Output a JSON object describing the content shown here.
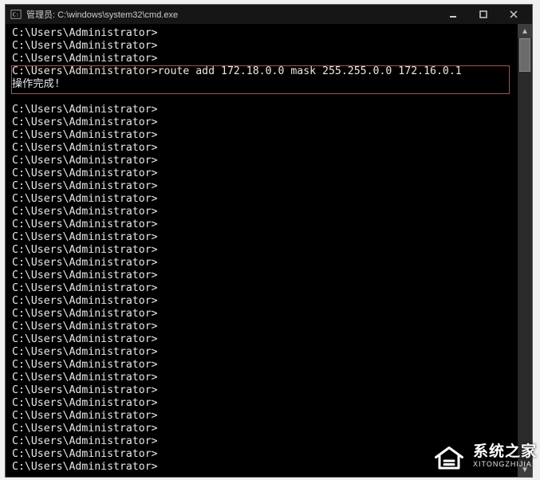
{
  "window": {
    "icon": "cmd-icon",
    "title": "管理员: C:\\windows\\system32\\cmd.exe"
  },
  "prompt": "C:\\Users\\Administrator>",
  "command": "route add 172.18.0.0 mask 255.255.0.0 172.16.0.1",
  "result": "操作完成!",
  "scrollbar": {
    "up": "▲",
    "down": "▼"
  },
  "watermark": {
    "cn": "系统之家",
    "en": "XITONGZHIJIA."
  }
}
